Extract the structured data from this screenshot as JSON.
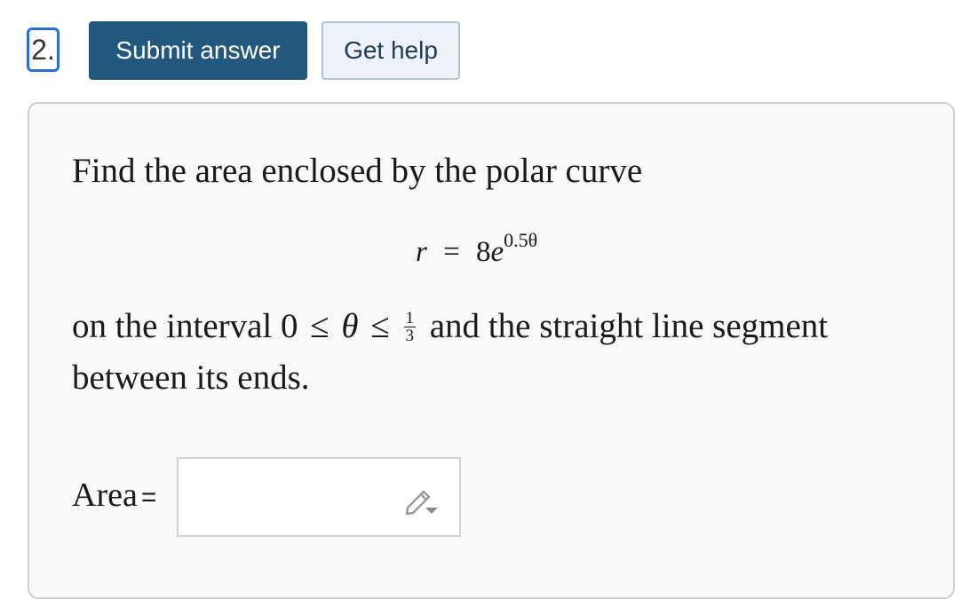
{
  "question": {
    "number": "2."
  },
  "toolbar": {
    "submit_label": "Submit answer",
    "help_label": "Get help"
  },
  "problem": {
    "intro": "Find the area enclosed by the polar curve",
    "equation": {
      "lhs": "r",
      "rel": "=",
      "base": "8",
      "e": "e",
      "exponent": "0.5θ"
    },
    "interval": {
      "prefix": "on the interval ",
      "lower": "0",
      "rel1": "≤",
      "var": "θ",
      "rel2": "≤",
      "frac_num": "1",
      "frac_den": "3",
      "suffix": "and the straight line segment"
    },
    "line2": "between its ends."
  },
  "answer": {
    "label": "Area",
    "equals": "=",
    "value": "",
    "icon": "pencil-icon"
  }
}
